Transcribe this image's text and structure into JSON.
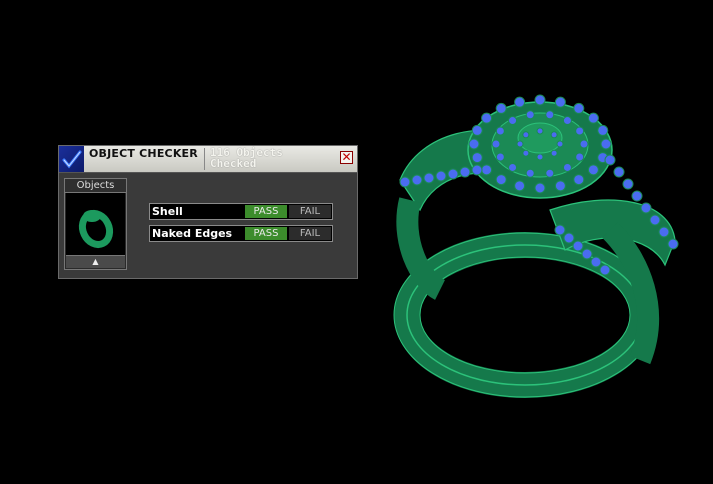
{
  "panel": {
    "title": "OBJECT CHECKER",
    "count_line1": "116  Objects",
    "count_line2": "Checked",
    "close_glyph": "✕",
    "objects_label": "Objects",
    "scroll_glyph": "▲",
    "checks": [
      {
        "label": "Shell",
        "pass": "PASS",
        "fail": "FAIL",
        "result": "pass"
      },
      {
        "label": "Naked Edges",
        "pass": "PASS",
        "fail": "FAIL",
        "result": "pass"
      }
    ]
  },
  "colors": {
    "ring_green": "#1f8f5a",
    "gem_blue": "#4a6cf0",
    "pass_green": "#3c8c2c",
    "logo_blue": "#1b2f9a"
  },
  "icons": [
    "checkmark-logo-icon",
    "close-icon",
    "scroll-up-icon",
    "ring-thumbnail-icon"
  ]
}
